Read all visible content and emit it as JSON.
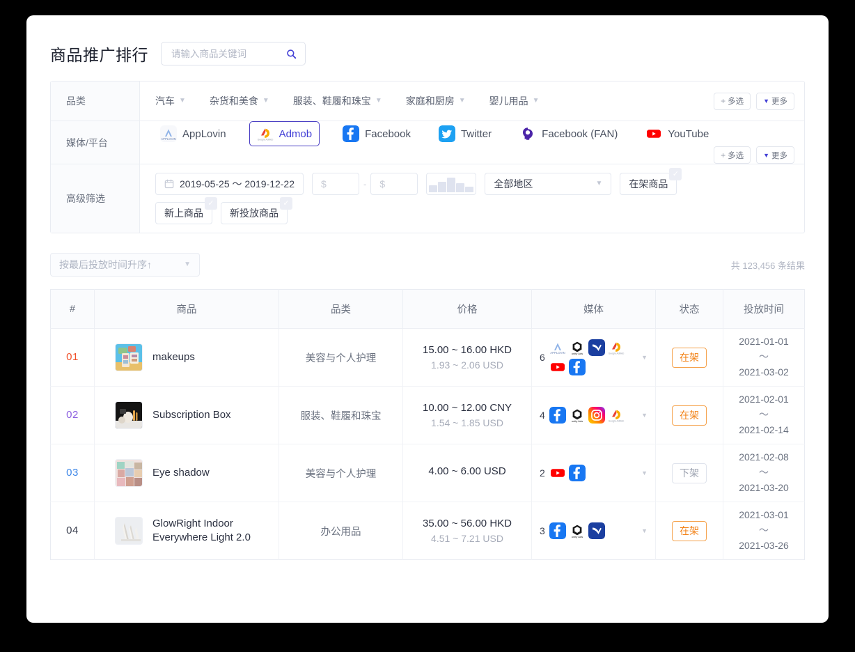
{
  "header": {
    "title": "商品推广排行",
    "search": {
      "value": "",
      "placeholder": "请输入商品关键词",
      "icon": "search-icon"
    }
  },
  "filters": {
    "category": {
      "label": "品类",
      "items": [
        "汽车",
        "杂货和美食",
        "服装、鞋履和珠宝",
        "家庭和厨房",
        "婴儿用品"
      ],
      "multi_label": "多选",
      "more_label": "更多"
    },
    "media": {
      "label": "媒体/平台",
      "items": [
        {
          "name": "AppLovin",
          "icon": "applovin-icon",
          "selected": false
        },
        {
          "name": "Admob",
          "icon": "admob-icon",
          "selected": true
        },
        {
          "name": "Facebook",
          "icon": "facebook-icon",
          "selected": false
        },
        {
          "name": "Twitter",
          "icon": "twitter-icon",
          "selected": false
        },
        {
          "name": "Facebook (FAN)",
          "icon": "facebook-fan-icon",
          "selected": false
        },
        {
          "name": "YouTube",
          "icon": "youtube-icon",
          "selected": false
        }
      ],
      "multi_label": "多选",
      "more_label": "更多"
    },
    "advanced": {
      "label": "高级筛选",
      "date_range": "2019-05-25 ～ 2019-12-22",
      "price_min_placeholder": "$",
      "price_min_value": "",
      "price_max_placeholder": "$",
      "price_max_value": "",
      "price_separator": "-",
      "histogram": [
        40,
        62,
        88,
        55,
        34
      ],
      "region": "全部地区",
      "chips": [
        "在架商品",
        "新上商品",
        "新投放商品"
      ]
    }
  },
  "toolbar": {
    "sort_label": "按最后投放时间升序↑",
    "result_count": "共 123,456 条结果"
  },
  "table": {
    "columns": [
      "#",
      "商品",
      "品类",
      "价格",
      "媒体",
      "状态",
      "投放时间"
    ],
    "rows": [
      {
        "rank": "01",
        "rank_color": "#f0502a",
        "product": "makeups",
        "thumb": "makeups-thumb",
        "category": "美容与个人护理",
        "price_main": "15.00 ~ 16.00 HKD",
        "price_sub": "1.93 ~ 2.06 USD",
        "media_count": "6",
        "media_icons": [
          "applovin-icon",
          "unity-ads-icon",
          "vungle-icon",
          "admob-icon",
          "youtube-icon",
          "facebook-icon"
        ],
        "status": "在架",
        "status_state": "on",
        "time_start": "2021-01-01",
        "time_sep": "～",
        "time_end": "2021-03-02"
      },
      {
        "rank": "02",
        "rank_color": "#8c5fe0",
        "product": "Subscription Box",
        "thumb": "subscription-box-thumb",
        "category": "服装、鞋履和珠宝",
        "price_main": "10.00 ~ 12.00 CNY",
        "price_sub": "1.54 ~ 1.85  USD",
        "media_count": "4",
        "media_icons": [
          "facebook-icon",
          "unity-ads-icon",
          "instagram-icon",
          "admob-icon"
        ],
        "status": "在架",
        "status_state": "on",
        "time_start": "2021-02-01",
        "time_sep": "～",
        "time_end": "2021-02-14"
      },
      {
        "rank": "03",
        "rank_color": "#3c86e8",
        "product": "Eye shadow",
        "thumb": "eye-shadow-thumb",
        "category": "美容与个人护理",
        "price_main": "4.00 ~ 6.00 USD",
        "price_sub": "",
        "media_count": "2",
        "media_icons": [
          "youtube-icon",
          "facebook-icon"
        ],
        "status": "下架",
        "status_state": "off",
        "time_start": "2021-02-08",
        "time_sep": "～",
        "time_end": "2021-03-20"
      },
      {
        "rank": "04",
        "rank_color": "#3c4150",
        "product": "GlowRight Indoor Everywhere Light 2.0",
        "thumb": "glowright-light-thumb",
        "category": "办公用品",
        "price_main": "35.00 ~ 56.00 HKD",
        "price_sub": "4.51 ~ 7.21  USD",
        "media_count": "3",
        "media_icons": [
          "facebook-icon",
          "unity-ads-icon",
          "vungle-icon"
        ],
        "status": "在架",
        "status_state": "on",
        "time_start": "2021-03-01",
        "time_sep": "～",
        "time_end": "2021-03-26"
      }
    ]
  },
  "colors": {
    "accent": "#4340d6",
    "status_on": "#f28115",
    "status_off": "#9aa0ae"
  }
}
